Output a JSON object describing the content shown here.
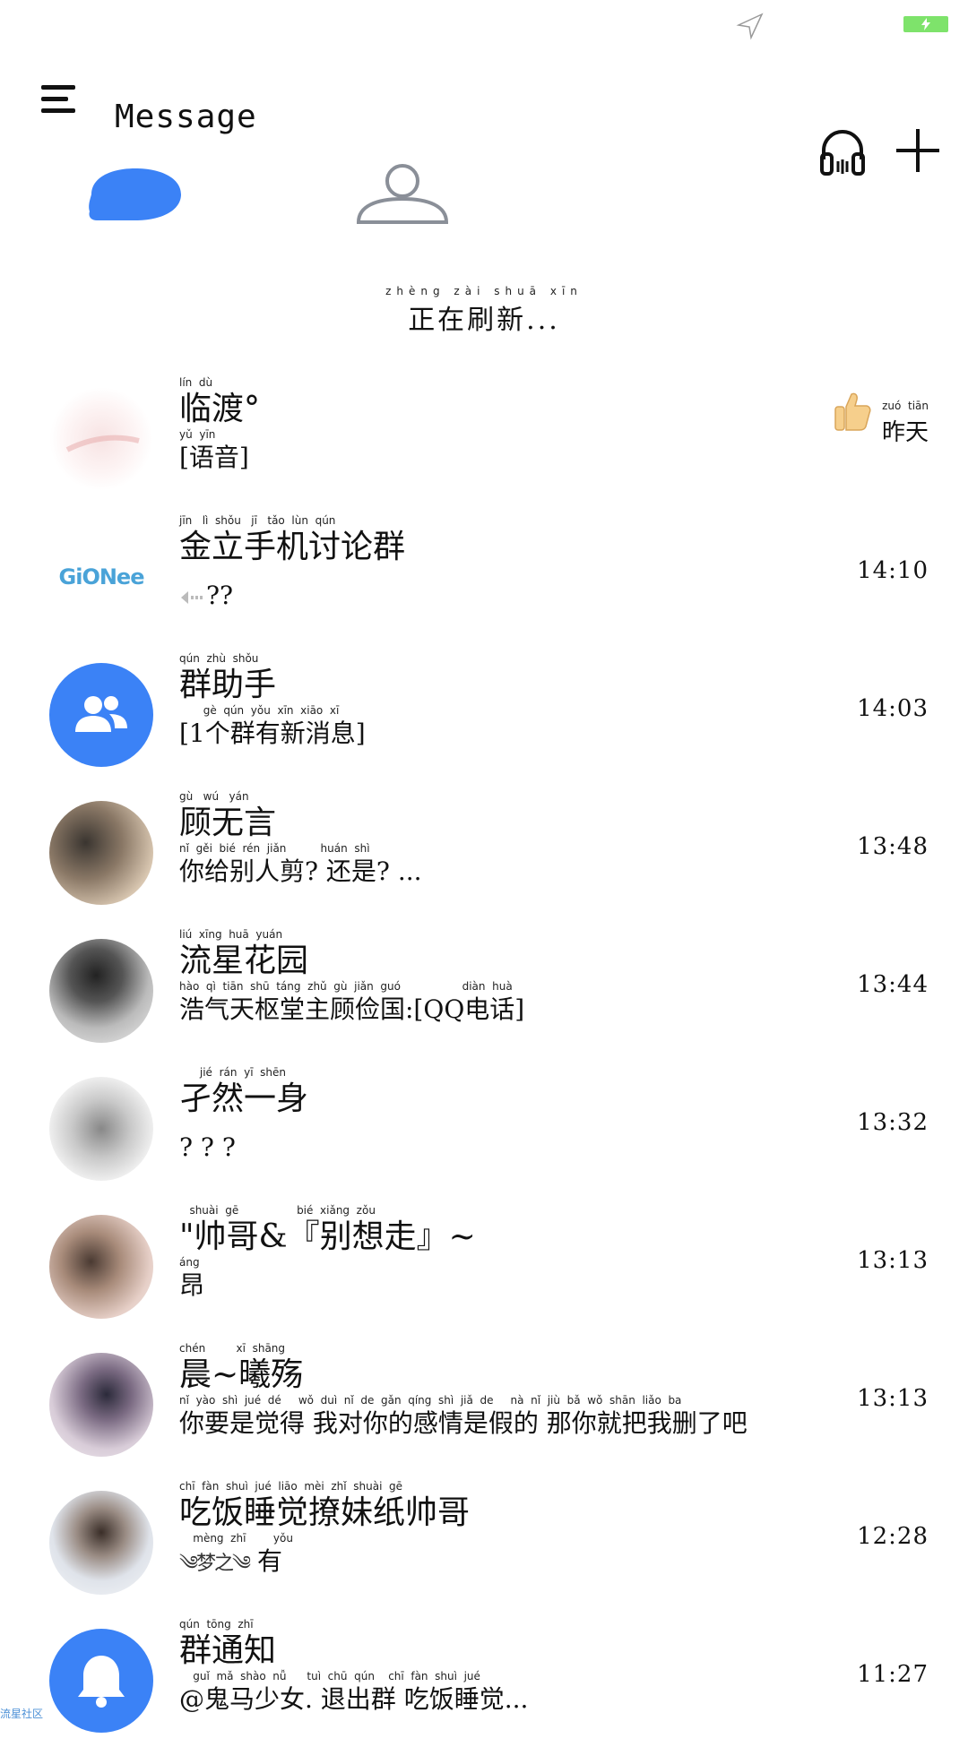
{
  "header": {
    "title": "Message",
    "tabs": [
      {
        "name": "messages",
        "icon": "chat-bubble-icon",
        "active": true
      },
      {
        "name": "contacts",
        "icon": "person-icon",
        "active": false
      }
    ]
  },
  "refresh": {
    "pinyin": "zhèng zài shuā xīn",
    "text": "正在刷新..."
  },
  "conversations": [
    {
      "name_pinyin": "lín  dù",
      "name": "临渡°",
      "msg_pinyin": "yǔ  yīn",
      "message": "[语音]",
      "time_pinyin": "zuó  tiān",
      "time": "昨天",
      "badge_icon": "thumbs-up-icon"
    },
    {
      "name_pinyin": "jīn   lì  shǒu   jī   tǎo  lùn  qún",
      "name": "金立手机讨论群",
      "msg_pinyin": "",
      "message": "??",
      "time": "14:10",
      "avatar_text": "GiONee"
    },
    {
      "name_pinyin": "qún  zhù  shǒu",
      "name": "群助手",
      "msg_pinyin": "       gè  qún  yǒu  xīn  xiāo  xī",
      "message": "[1个群有新消息]",
      "time": "14:03"
    },
    {
      "name_pinyin": "gù   wú   yán",
      "name": "顾无言",
      "msg_pinyin": "nǐ  gěi  bié  rén  jiǎn          huán  shì",
      "message": "你给别人剪? 还是? ...",
      "time": "13:48"
    },
    {
      "name_pinyin": "liú  xīng  huā  yuán",
      "name": "流星花园",
      "msg_pinyin": "hào  qì  tiān  shū  táng  zhǔ  gù  jiǎn  guó                  diàn  huà",
      "message": "浩气天枢堂主顾俭国:[QQ电话]",
      "time": "13:44"
    },
    {
      "name_pinyin": "      jié  rán  yī  shēn",
      "name": "  孑然一身",
      "msg_pinyin": "",
      "message": "? ? ?",
      "time": "13:32"
    },
    {
      "name_pinyin": "   shuài  gē                 bié  xiǎng  zǒu",
      "name": "\"帅哥&『别想走』~",
      "msg_pinyin": "áng",
      "message": "昂",
      "time": "13:13"
    },
    {
      "name_pinyin": "chén         xī  shāng",
      "name": "晨~曦殇",
      "msg_pinyin": "nǐ  yào  shì  jué  dé     wǒ  duì  nǐ  de  gǎn  qíng  shì  jiǎ  de     nà  nǐ  jiù  bǎ  wǒ  shān  liǎo  ba",
      "message": "你要是觉得 我对你的感情是假的 那你就把我删了吧",
      "time": "13:13"
    },
    {
      "name_pinyin": "chī  fàn  shuì  jué  liāo  mèi  zhǐ  shuài  gē",
      "name": "吃饭睡觉撩妹纸帅哥",
      "msg_pinyin": "    mèng  zhī        yǒu",
      "message": "有",
      "msg_prefix": "༄梦之༄",
      "time": "12:28"
    },
    {
      "name_pinyin": "qún  tōng  zhī",
      "name": "群通知",
      "msg_pinyin": "    guǐ  mǎ  shào  nǚ      tuì  chū  qún    chī  fàn  shuì  jué",
      "message": "@鬼马少女. 退出群 吃饭睡觉...",
      "time": "11:27"
    }
  ],
  "watermark": "流星社区",
  "colors": {
    "accent": "#3b82f6",
    "battery": "#7ee36b"
  }
}
